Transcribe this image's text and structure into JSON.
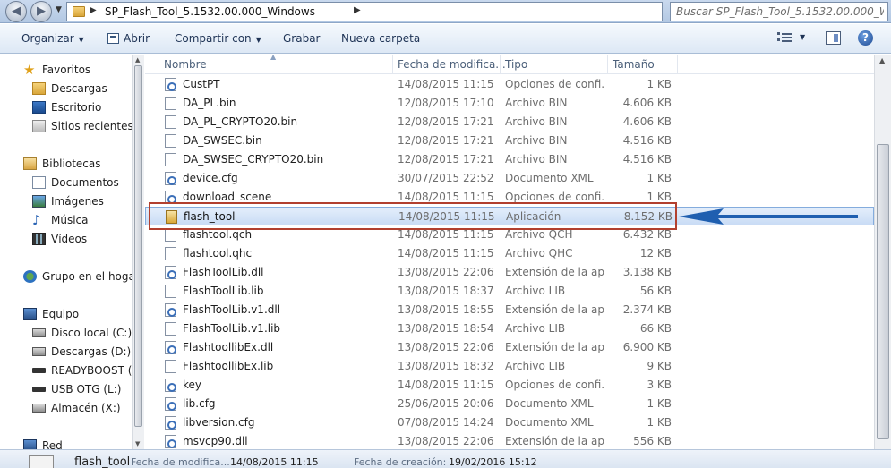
{
  "address": {
    "path": "SP_Flash_Tool_5.1532.00.000_Windows",
    "search_placeholder": "Buscar SP_Flash_Tool_5.1532.00.000_W..."
  },
  "toolbar": {
    "organize": "Organizar",
    "open": "Abrir",
    "share": "Compartir con",
    "burn": "Grabar",
    "new_folder": "Nueva carpeta",
    "help": "?"
  },
  "nav": {
    "favorites": "Favoritos",
    "downloads": "Descargas",
    "desktop": "Escritorio",
    "recent": "Sitios recientes",
    "libraries": "Bibliotecas",
    "documents": "Documentos",
    "images": "Imágenes",
    "music": "Música",
    "videos": "Vídeos",
    "homegroup": "Grupo en el hogar",
    "computer": "Equipo",
    "local_disk": "Disco local (C:)",
    "downloads_drive": "Descargas (D:)",
    "readyboost": "READYBOOST (G:)",
    "usb_otg": "USB OTG (L:)",
    "storage": "Almacén (X:)",
    "network": "Red"
  },
  "columns": {
    "name": "Nombre",
    "date": "Fecha de modifica...",
    "type": "Tipo",
    "size": "Tamaño"
  },
  "files": [
    {
      "name": "CustPT",
      "date": "14/08/2015 11:15",
      "type": "Opciones de confi...",
      "size": "1 KB"
    },
    {
      "name": "DA_PL.bin",
      "date": "12/08/2015 17:10",
      "type": "Archivo BIN",
      "size": "4.606 KB"
    },
    {
      "name": "DA_PL_CRYPTO20.bin",
      "date": "12/08/2015 17:21",
      "type": "Archivo BIN",
      "size": "4.606 KB"
    },
    {
      "name": "DA_SWSEC.bin",
      "date": "12/08/2015 17:21",
      "type": "Archivo BIN",
      "size": "4.516 KB"
    },
    {
      "name": "DA_SWSEC_CRYPTO20.bin",
      "date": "12/08/2015 17:21",
      "type": "Archivo BIN",
      "size": "4.516 KB"
    },
    {
      "name": "device.cfg",
      "date": "30/07/2015 22:52",
      "type": "Documento XML",
      "size": "1 KB"
    },
    {
      "name": "download_scene",
      "date": "14/08/2015 11:15",
      "type": "Opciones de confi...",
      "size": "1 KB"
    },
    {
      "name": "flash_tool",
      "date": "14/08/2015 11:15",
      "type": "Aplicación",
      "size": "8.152 KB"
    },
    {
      "name": "flashtool.qch",
      "date": "14/08/2015 11:15",
      "type": "Archivo QCH",
      "size": "6.432 KB"
    },
    {
      "name": "flashtool.qhc",
      "date": "14/08/2015 11:15",
      "type": "Archivo QHC",
      "size": "12 KB"
    },
    {
      "name": "FlashToolLib.dll",
      "date": "13/08/2015 22:06",
      "type": "Extensión de la apl...",
      "size": "3.138 KB"
    },
    {
      "name": "FlashToolLib.lib",
      "date": "13/08/2015 18:37",
      "type": "Archivo LIB",
      "size": "56 KB"
    },
    {
      "name": "FlashToolLib.v1.dll",
      "date": "13/08/2015 18:55",
      "type": "Extensión de la apl...",
      "size": "2.374 KB"
    },
    {
      "name": "FlashToolLib.v1.lib",
      "date": "13/08/2015 18:54",
      "type": "Archivo LIB",
      "size": "66 KB"
    },
    {
      "name": "FlashtoollibEx.dll",
      "date": "13/08/2015 22:06",
      "type": "Extensión de la apl...",
      "size": "6.900 KB"
    },
    {
      "name": "FlashtoollibEx.lib",
      "date": "13/08/2015 18:32",
      "type": "Archivo LIB",
      "size": "9 KB"
    },
    {
      "name": "key",
      "date": "14/08/2015 11:15",
      "type": "Opciones de confi...",
      "size": "3 KB"
    },
    {
      "name": "lib.cfg",
      "date": "25/06/2015 20:06",
      "type": "Documento XML",
      "size": "1 KB"
    },
    {
      "name": "libversion.cfg",
      "date": "07/08/2015 14:24",
      "type": "Documento XML",
      "size": "1 KB"
    },
    {
      "name": "msvcp90.dll",
      "date": "13/08/2015 22:06",
      "type": "Extensión de la apl...",
      "size": "556 KB"
    }
  ],
  "details": {
    "name": "flash_tool",
    "modified_label": "Fecha de modifica...",
    "modified_value": "14/08/2015 11:15",
    "created_label": "Fecha de creación:",
    "created_value": "19/02/2016 15:12"
  },
  "colors": {
    "highlight_box": "#b2402f",
    "arrow": "#1f5fb0",
    "selection": "#c9dcf5"
  }
}
